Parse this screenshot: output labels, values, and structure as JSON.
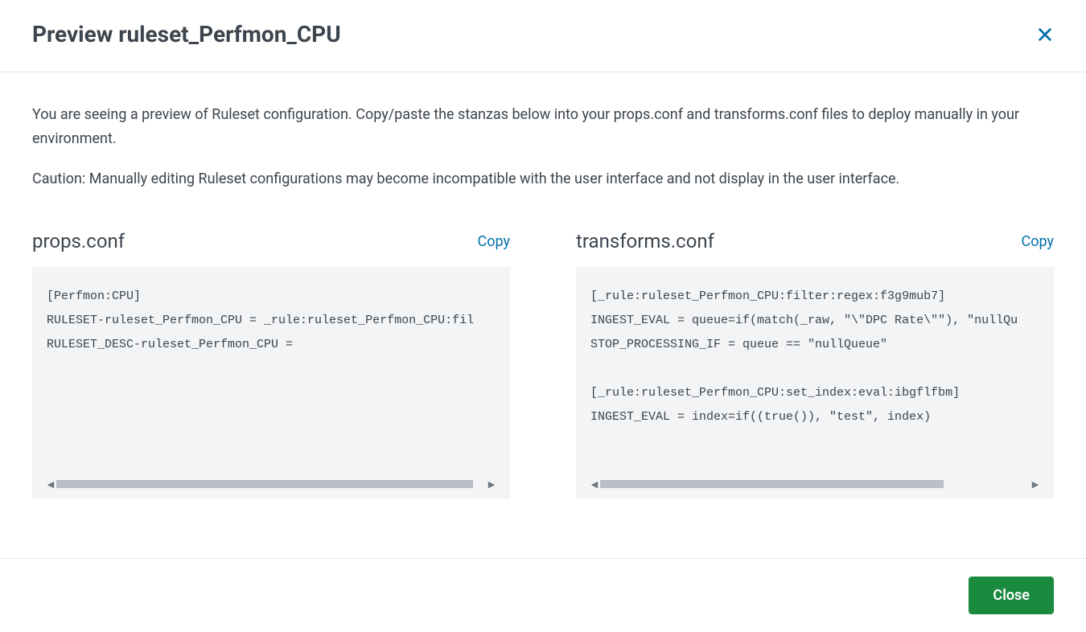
{
  "header": {
    "title": "Preview ruleset_Perfmon_CPU"
  },
  "body": {
    "description": "You are seeing a preview of Ruleset configuration. Copy/paste the stanzas below into your props.conf and transforms.conf files to deploy manually in your environment.",
    "caution": "Caution: Manually editing Ruleset configurations may become incompatible with the user interface and not display in the user interface."
  },
  "panels": {
    "props": {
      "title": "props.conf",
      "copy_label": "Copy",
      "content": "[Perfmon:CPU]\nRULESET-ruleset_Perfmon_CPU = _rule:ruleset_Perfmon_CPU:fil\nRULESET_DESC-ruleset_Perfmon_CPU ="
    },
    "transforms": {
      "title": "transforms.conf",
      "copy_label": "Copy",
      "content": "[_rule:ruleset_Perfmon_CPU:filter:regex:f3g9mub7]\nINGEST_EVAL = queue=if(match(_raw, \"\\\"DPC Rate\\\"\"), \"nullQu\nSTOP_PROCESSING_IF = queue == \"nullQueue\"\n\n[_rule:ruleset_Perfmon_CPU:set_index:eval:ibgflfbm]\nINGEST_EVAL = index=if((true()), \"test\", index)"
    }
  },
  "footer": {
    "close_label": "Close"
  }
}
